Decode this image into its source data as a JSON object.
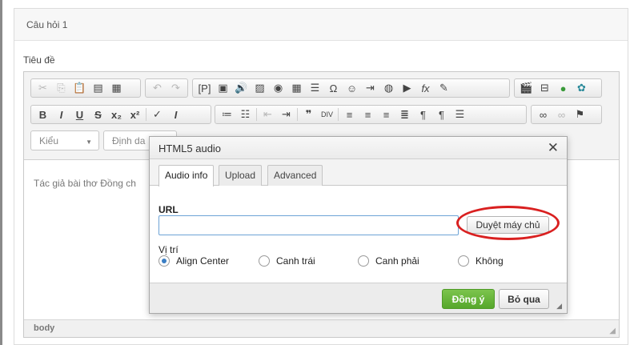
{
  "panel": {
    "title": "Câu hỏi 1",
    "field_label": "Tiêu đề"
  },
  "editor": {
    "combo_style": "Kiểu",
    "combo_format": "Định da",
    "content_text": "Tác giả bài thơ Đồng ch",
    "status_path": "body"
  },
  "toolbar_icons": {
    "row1_group1": [
      "cut-icon",
      "copy-icon",
      "paste-icon",
      "paste-text-icon",
      "paste-word-icon"
    ],
    "row1_group2": [
      "undo-icon",
      "redo-icon"
    ],
    "row1_group3": [
      "placeholder-icon",
      "flash-icon",
      "audio-icon",
      "image-icon",
      "html5-icon",
      "table-icon",
      "horizontal-rule-icon",
      "special-char-icon",
      "smiley-icon",
      "page-break-icon",
      "iframe-icon",
      "youtube-icon",
      "math-icon",
      "edit-icon"
    ],
    "row1_group4": [
      "video-icon",
      "template-icon",
      "globe-icon",
      "paint-icon"
    ],
    "row2_group1": [
      "bold-icon",
      "italic-icon",
      "underline-icon",
      "strike-icon",
      "subscript-icon",
      "superscript-icon",
      "remove-format-icon",
      "clear-format-icon"
    ],
    "row2_group2": [
      "numbered-list-icon",
      "bulleted-list-icon",
      "outdent-icon",
      "indent-icon",
      "blockquote-icon",
      "div-icon",
      "align-left-icon",
      "align-center-icon",
      "align-right-icon",
      "justify-icon",
      "ltr-icon",
      "rtl-icon",
      "language-icon"
    ],
    "row2_group3": [
      "link-icon",
      "unlink-icon",
      "anchor-icon"
    ]
  },
  "dialog": {
    "title": "HTML5 audio",
    "close_glyph": "✕",
    "tabs": [
      "Audio info",
      "Upload",
      "Advanced"
    ],
    "url_label": "URL",
    "url_value": "",
    "browse_label": "Duyệt máy chủ",
    "position_label": "Vị trí",
    "position_options": [
      "Align Center",
      "Canh trái",
      "Canh phải",
      "Không"
    ],
    "position_selected": "Align Center",
    "ok_label": "Đồng ý",
    "cancel_label": "Bỏ qua"
  },
  "colors": {
    "accent_green": "#56a72b",
    "highlight_ring": "#d92020",
    "input_border": "#6da3d6"
  }
}
